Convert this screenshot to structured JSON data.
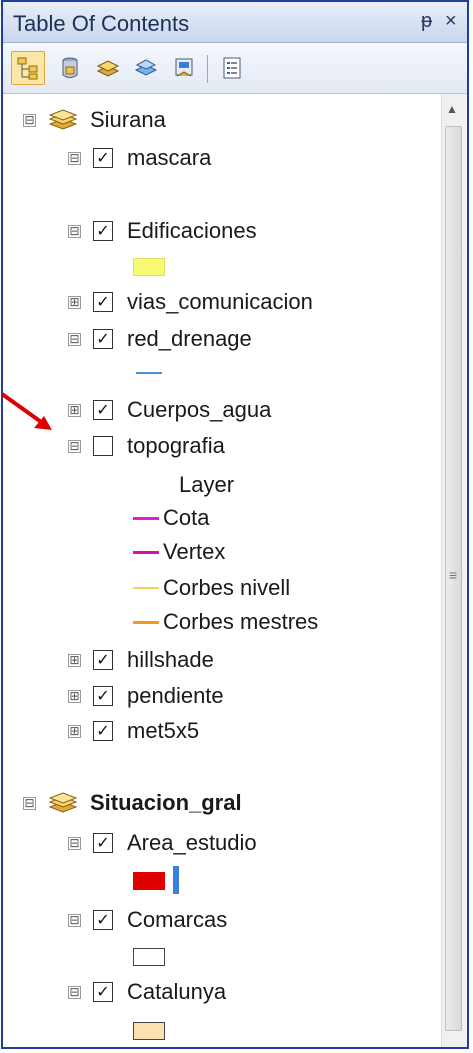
{
  "panel": {
    "title": "Table Of Contents",
    "pin_glyph": "ᵽ",
    "close_glyph": "×"
  },
  "toolbar": {
    "tools": [
      {
        "name": "list-by-drawing-order",
        "icon": "layers-tree-icon"
      },
      {
        "name": "list-by-source",
        "icon": "database-icon"
      },
      {
        "name": "list-by-visibility",
        "icon": "layer-stack-icon"
      },
      {
        "name": "list-by-selection",
        "icon": "selection-icon"
      },
      {
        "name": "options",
        "icon": "options-list-icon"
      }
    ]
  },
  "groups": [
    {
      "name": "Siurana",
      "expander": "⊟",
      "layers": [
        {
          "label": "mascara",
          "expander": "⊟",
          "checked": true
        },
        {
          "label": "Edificaciones",
          "expander": "⊟",
          "checked": true,
          "swatch_color": "#f8fa72"
        },
        {
          "label": "vias_comunicacion",
          "expander": "⊞",
          "checked": true
        },
        {
          "label": "red_drenage",
          "expander": "⊟",
          "checked": true,
          "line_color": "#4a90d9"
        },
        {
          "label": "Cuerpos_agua",
          "expander": "⊞",
          "checked": true
        },
        {
          "label": "topografia",
          "expander": "⊟",
          "checked": false,
          "legend_header": "Layer",
          "legend": [
            {
              "label": "Cota",
              "color": "#e01ccc"
            },
            {
              "label": "Vertex",
              "color": "#d60fb0"
            },
            {
              "label": "Corbes nivell",
              "color": "#f3d25a"
            },
            {
              "label": "Corbes mestres",
              "color": "#f59a20"
            }
          ]
        },
        {
          "label": "hillshade",
          "expander": "⊞",
          "checked": true
        },
        {
          "label": "pendiente",
          "expander": "⊞",
          "checked": true
        },
        {
          "label": "met5x5",
          "expander": "⊞",
          "checked": true
        }
      ]
    },
    {
      "name": "Situacion_gral",
      "expander": "⊟",
      "layers": [
        {
          "label": "Area_estudio",
          "expander": "⊟",
          "checked": true,
          "swatch_color": "#e00000",
          "secondary_color": "#3a7fd8"
        },
        {
          "label": "Comarcas",
          "expander": "⊟",
          "checked": true,
          "swatch_color": "#ffffff"
        },
        {
          "label": "Catalunya",
          "expander": "⊟",
          "checked": true,
          "swatch_color": "#fbe0b0"
        }
      ]
    }
  ],
  "annotation": {
    "arrow_color": "#e00000"
  },
  "scrollbar": {
    "up_glyph": "▲",
    "grip_glyph": "≡"
  }
}
